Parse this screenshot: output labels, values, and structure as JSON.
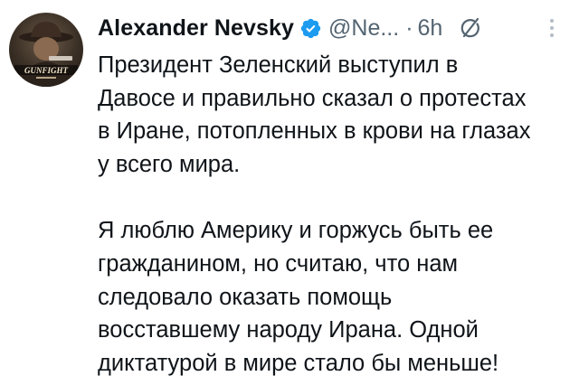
{
  "post": {
    "author_name": "Alexander Nevsky",
    "handle": "@Ne...",
    "separator": "·",
    "time": "6h",
    "avatar_text": "GUNFIGHT",
    "paragraphs": [
      {
        "lines": [
          "Президент Зеленский выступил в",
          "Давосе и правильно сказал о протестах",
          "в Иране, потопленных в крови на глазах",
          "у всего мира."
        ]
      },
      {
        "lines": [
          "Я люблю Америку и горжусь быть ее",
          "гражданином, но считаю, что нам",
          "следовало оказать помощь",
          "восставшему народу Ирана. Одной",
          "диктатурой в мире стало бы меньше!"
        ]
      }
    ]
  },
  "colors": {
    "text": "#0f1419",
    "muted": "#536471",
    "verified": "#1d9bf0"
  },
  "icons": {
    "verified": "verified-badge-icon",
    "grok": "grok-icon",
    "more": "more-options-icon"
  }
}
